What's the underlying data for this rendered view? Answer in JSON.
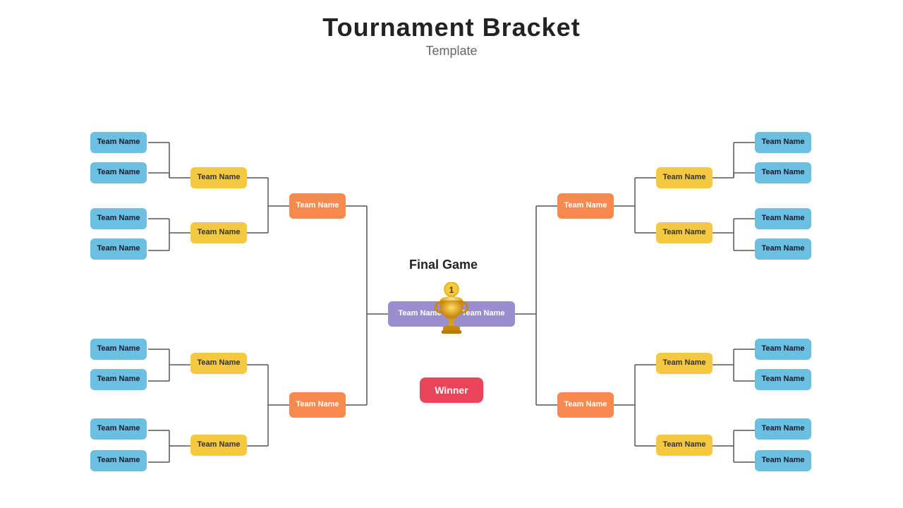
{
  "title": "Tournament Bracket",
  "subtitle": "Template",
  "finalGame": "Final Game",
  "winner": "Winner",
  "teamLabel": "Team Name",
  "colors": {
    "blue": "#6bbfe0",
    "yellow": "#f5c842",
    "orange": "#f5894e",
    "purple": "#9b8ecf",
    "red": "#e8455a"
  }
}
